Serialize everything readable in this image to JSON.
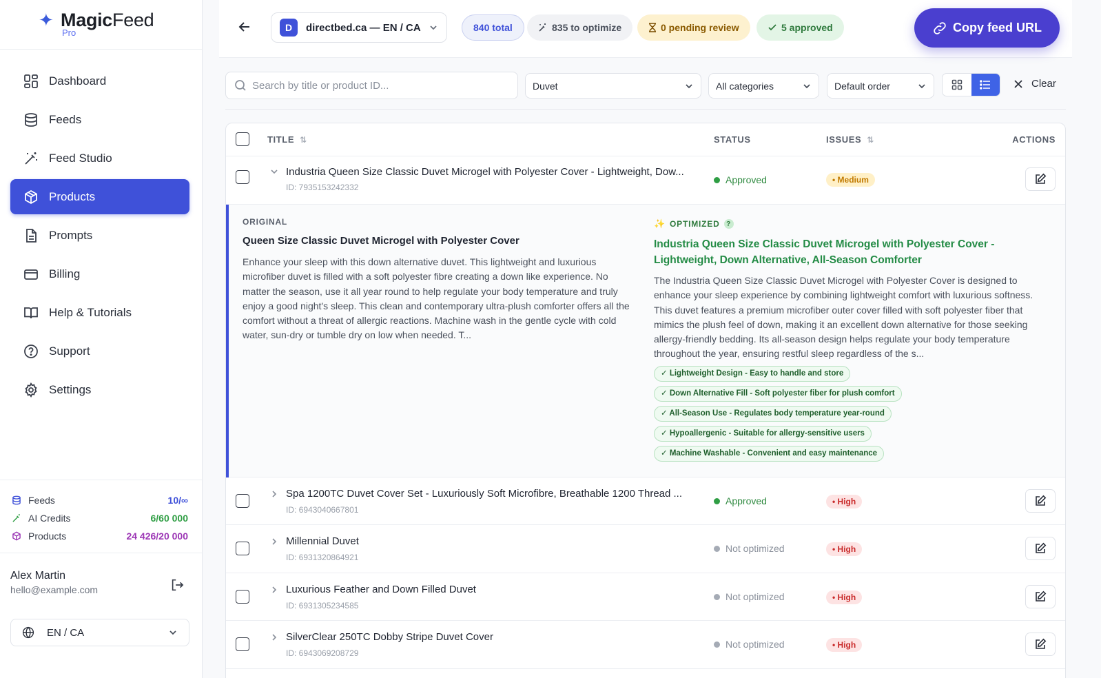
{
  "brand": {
    "name_bold": "Magic",
    "name_rest": "Feed",
    "tier": "Pro"
  },
  "nav": [
    {
      "label": "Dashboard",
      "icon": "dashboard-icon",
      "active": false
    },
    {
      "label": "Feeds",
      "icon": "database-icon",
      "active": false
    },
    {
      "label": "Feed Studio",
      "icon": "magic-wand-icon",
      "active": false
    },
    {
      "label": "Products",
      "icon": "box-icon",
      "active": true
    },
    {
      "label": "Prompts",
      "icon": "document-icon",
      "active": false
    },
    {
      "label": "Billing",
      "icon": "credit-card-icon",
      "active": false
    },
    {
      "label": "Help & Tutorials",
      "icon": "book-icon",
      "active": false
    },
    {
      "label": "Support",
      "icon": "help-circle-icon",
      "active": false
    },
    {
      "label": "Settings",
      "icon": "gear-icon",
      "active": false
    }
  ],
  "usage": [
    {
      "label": "Feeds",
      "value": "10/∞",
      "color": "#3f51d9"
    },
    {
      "label": "AI Credits",
      "value": "6/60 000",
      "color": "#2f9e44"
    },
    {
      "label": "Products",
      "value": "24 426/20 000",
      "color": "#9c36b5"
    }
  ],
  "user": {
    "name": "Alex Martin",
    "email": "hello@example.com"
  },
  "language": "EN / CA",
  "topbar": {
    "feed_letter": "D",
    "feed_name": "directbed.ca — EN / CA",
    "total": "840 total",
    "to_optimize": "835 to optimize",
    "pending": "0 pending review",
    "approved": "5 approved",
    "copy_button": "Copy feed URL"
  },
  "filters": {
    "search_placeholder": "Search by title or product ID...",
    "query_select": "Duvet",
    "category_select": "All categories",
    "order_select": "Default order",
    "clear_label": "Clear"
  },
  "table": {
    "headers": {
      "title": "TITLE",
      "status": "STATUS",
      "issues": "ISSUES",
      "actions": "ACTIONS"
    },
    "rows": [
      {
        "title": "Industria Queen Size Classic Duvet Microgel with Polyester Cover - Lightweight, Dow...",
        "id": "ID: 7935153242332",
        "status": "Approved",
        "issue": "Medium",
        "expanded": true
      },
      {
        "title": "Spa 1200TC Duvet Cover Set - Luxuriously Soft Microfibre, Breathable 1200 Thread ...",
        "id": "ID: 6943040667801",
        "status": "Approved",
        "issue": "High"
      },
      {
        "title": "Millennial Duvet",
        "id": "ID: 6931320864921",
        "status": "Not optimized",
        "issue": "High"
      },
      {
        "title": "Luxurious Feather and Down Filled Duvet",
        "id": "ID: 6931305234585",
        "status": "Not optimized",
        "issue": "High"
      },
      {
        "title": "SilverClear 250TC Dobby Stripe Duvet Cover",
        "id": "ID: 6943069208729",
        "status": "Not optimized",
        "issue": "High"
      }
    ]
  },
  "detail": {
    "original_label": "ORIGINAL",
    "original_title": "Queen Size Classic Duvet Microgel with Polyester Cover",
    "original_desc": "Enhance your sleep with this down alternative duvet. This lightweight and luxurious microfiber duvet is filled with a soft polyester fibre creating a down like experience. No matter the season, use it all year round to help regulate your body temperature and truly enjoy a good night's sleep. This clean and contemporary ultra-plush comforter offers all the comfort without a threat of allergic reactions. Machine wash in the gentle cycle with cold water, sun-dry or tumble dry on low when needed. T...",
    "optimized_label": "OPTIMIZED",
    "optimized_title": "Industria Queen Size Classic Duvet Microgel with Polyester Cover - Lightweight, Down Alternative, All-Season Comforter",
    "optimized_desc": "The Industria Queen Size Classic Duvet Microgel with Polyester Cover is designed to enhance your sleep experience by combining lightweight comfort with luxurious softness. This duvet features a premium microfiber outer cover filled with soft polyester fiber that mimics the plush feel of down, making it an excellent down alternative for those seeking allergy-friendly bedding. Its all-season design helps regulate your body temperature throughout the year, ensuring restful sleep regardless of the s...",
    "features": [
      "✓ Lightweight Design - Easy to handle and store",
      "✓ Down Alternative Fill - Soft polyester fiber for plush comfort",
      "✓ All-Season Use - Regulates body temperature year-round",
      "✓ Hypoallergenic - Suitable for allergy-sensitive users",
      "✓ Machine Washable - Convenient and easy maintenance"
    ]
  }
}
